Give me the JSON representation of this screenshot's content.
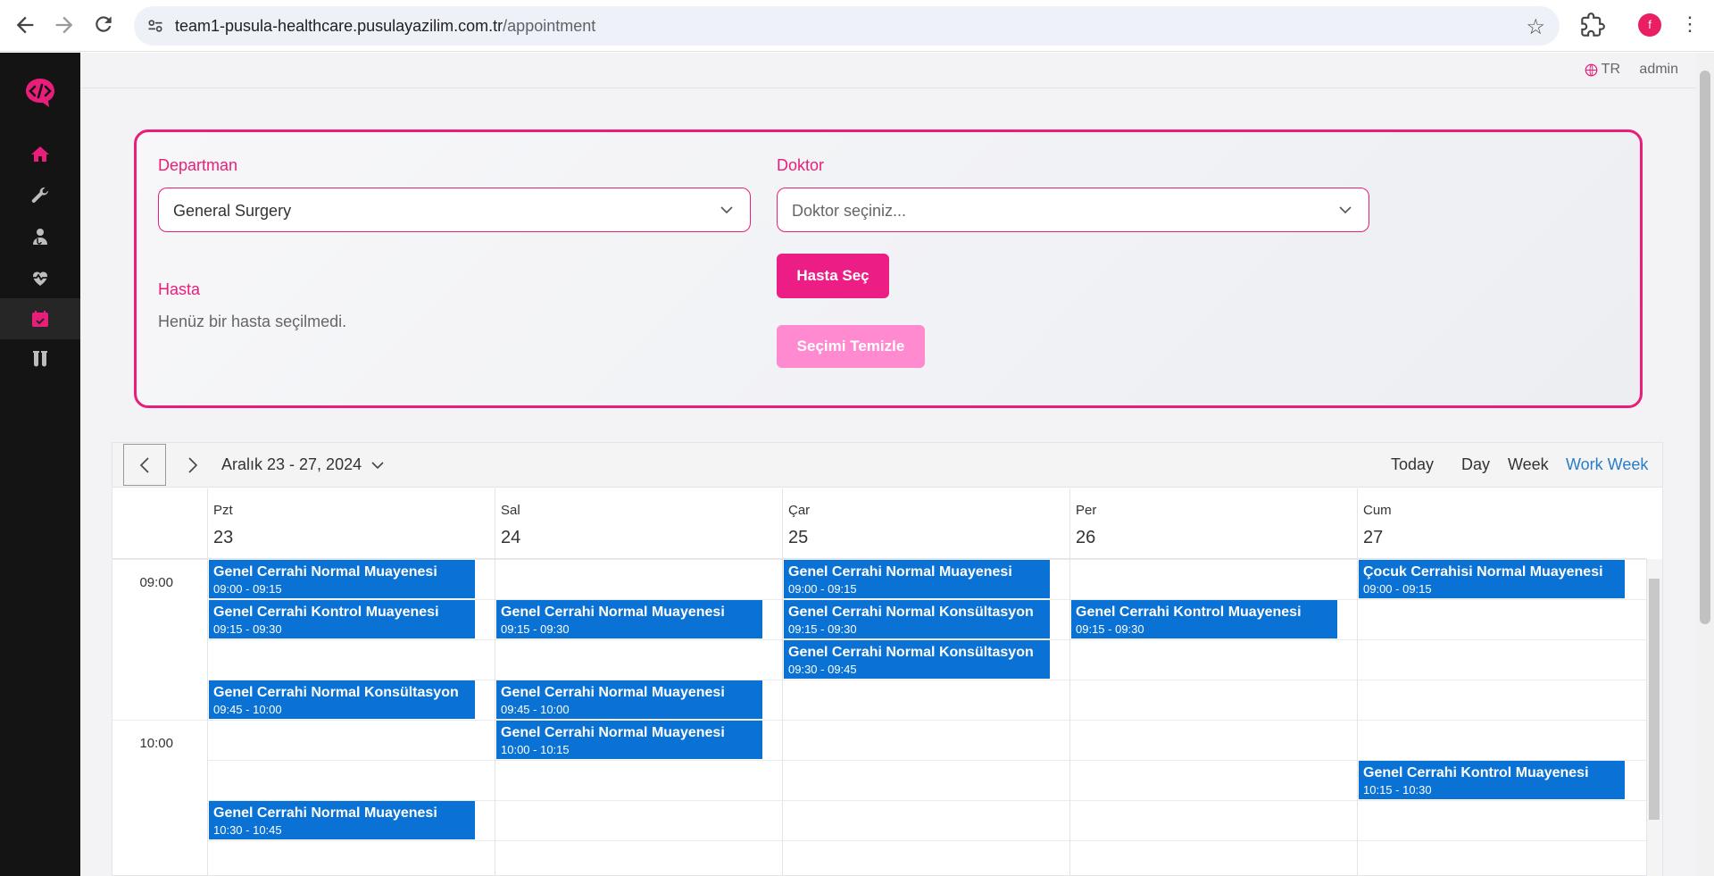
{
  "browser": {
    "url_host": "team1-pusula-healthcare.pusulayazilim.com.tr",
    "url_path": "/appointment",
    "profile_initial": "f"
  },
  "header": {
    "language": "TR",
    "user": "admin"
  },
  "sidebar": {
    "items": [
      {
        "icon": "home-icon",
        "active": false
      },
      {
        "icon": "wrench-icon",
        "active": false
      },
      {
        "icon": "doctor-icon",
        "active": false
      },
      {
        "icon": "heart-pulse-icon",
        "active": false
      },
      {
        "icon": "calendar-icon",
        "active": true
      },
      {
        "icon": "test-tubes-icon",
        "active": false
      }
    ],
    "accent": "#e91e7a"
  },
  "filters": {
    "department_label": "Departman",
    "department_value": "General Surgery",
    "doctor_label": "Doktor",
    "doctor_placeholder": "Doktor seçiniz...",
    "patient_label": "Hasta",
    "patient_empty": "Henüz bir hasta seçilmedi.",
    "select_patient_button": "Hasta Seç",
    "clear_button": "Seçimi Temizle"
  },
  "scheduler": {
    "range": "Aralık 23 - 27, 2024",
    "views": [
      "Today",
      "Day",
      "Week",
      "Work Week"
    ],
    "active_view": "Work Week",
    "days": [
      {
        "name": "Pzt",
        "num": "23"
      },
      {
        "name": "Sal",
        "num": "24"
      },
      {
        "name": "Çar",
        "num": "25"
      },
      {
        "name": "Per",
        "num": "26"
      },
      {
        "name": "Cum",
        "num": "27"
      }
    ],
    "times": [
      "09:00",
      "10:00"
    ],
    "appointments": [
      {
        "day": 0,
        "title": "Genel Cerrahi Normal Muayenesi",
        "time": "09:00 - 09:15"
      },
      {
        "day": 0,
        "title": "Genel Cerrahi Kontrol Muayenesi",
        "time": "09:15 - 09:30"
      },
      {
        "day": 0,
        "title": "Genel Cerrahi Normal Konsültasyon",
        "time": "09:45 - 10:00"
      },
      {
        "day": 0,
        "title": "Genel Cerrahi Normal Muayenesi",
        "time": "10:30 - 10:45"
      },
      {
        "day": 1,
        "title": "Genel Cerrahi Normal Muayenesi",
        "time": "09:15 - 09:30"
      },
      {
        "day": 1,
        "title": "Genel Cerrahi Normal Muayenesi",
        "time": "09:45 - 10:00"
      },
      {
        "day": 1,
        "title": "Genel Cerrahi Normal Muayenesi",
        "time": "10:00 - 10:15"
      },
      {
        "day": 2,
        "title": "Genel Cerrahi Normal Muayenesi",
        "time": "09:00 - 09:15"
      },
      {
        "day": 2,
        "title": "Genel Cerrahi Normal Konsültasyon",
        "time": "09:15 - 09:30"
      },
      {
        "day": 2,
        "title": "Genel Cerrahi Normal Konsültasyon",
        "time": "09:30 - 09:45"
      },
      {
        "day": 3,
        "title": "Genel Cerrahi Kontrol Muayenesi",
        "time": "09:15 - 09:30"
      },
      {
        "day": 4,
        "title": "Çocuk Cerrahisi Normal Muayenesi",
        "time": "09:00 - 09:15"
      },
      {
        "day": 4,
        "title": "Genel Cerrahi Kontrol Muayenesi",
        "time": "10:15 - 10:30"
      }
    ],
    "appointment_color": "#0a72d4"
  }
}
